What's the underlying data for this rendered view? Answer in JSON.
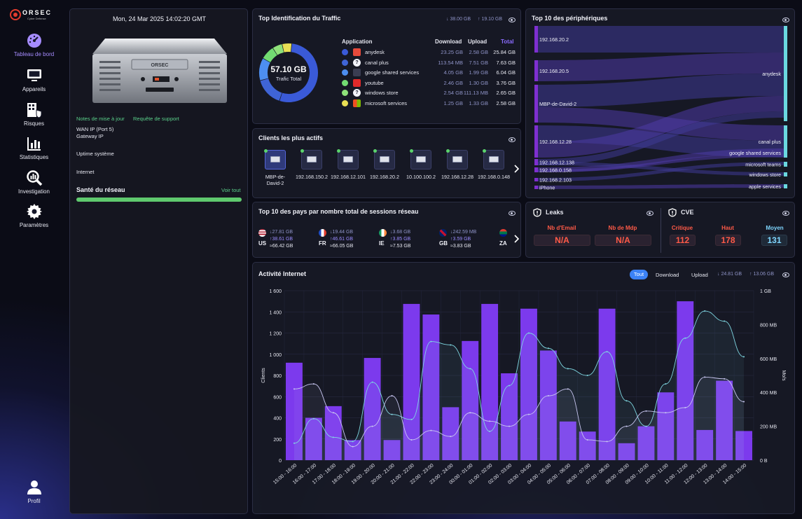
{
  "app": {
    "logo_text": "ORSEC",
    "logo_sub": "Cyber Defense"
  },
  "sidebar": {
    "items": [
      {
        "label": "Tableau de bord",
        "icon": "dashboard-gauge-icon"
      },
      {
        "label": "Appareils",
        "icon": "monitor-icon"
      },
      {
        "label": "Risques",
        "icon": "building-shield-icon"
      },
      {
        "label": "Statistiques",
        "icon": "bar-chart-icon"
      },
      {
        "label": "Investigation",
        "icon": "magnifier-chart-icon"
      },
      {
        "label": "Paramètres",
        "icon": "gear-icon"
      },
      {
        "label": "Profil",
        "icon": "user-icon"
      }
    ]
  },
  "device": {
    "datetime": "Mon, 24 Mar 2025 14:02:20 GMT",
    "notes_link": "Notes de mise à jour",
    "support_link": "Requête de support",
    "wan_ip": "WAN IP (Port 5)",
    "gateway_ip": "Gateway IP",
    "uptime": "Uptime système",
    "internet": "Internet",
    "health_title": "Santé du réseau",
    "health_link": "Voir tout",
    "health_level": 100,
    "device_label": "ORSEC"
  },
  "traffic": {
    "title": "Top Identification du Traffic",
    "download_total": "↓ 38.00 GB",
    "upload_total": "↑ 19.10 GB",
    "donut_value": "57.10 GB",
    "donut_label": "Trafic Total",
    "headers": {
      "app": "Application",
      "download": "Download",
      "upload": "Upload",
      "total": "Total"
    },
    "rows": [
      {
        "color": "#3a5ad8",
        "icon": "anydesk-icon",
        "name": "anydesk",
        "download": "23.25 GB",
        "upload": "2.58 GB",
        "total": "25.84 GB"
      },
      {
        "color": "#3f64d6",
        "icon": "question-icon",
        "name": "canal plus",
        "download": "113.54 MB",
        "upload": "7.51 GB",
        "total": "7.63 GB"
      },
      {
        "color": "#4d8ef0",
        "icon": "google-icon",
        "name": "google shared services",
        "download": "4.05 GB",
        "upload": "1.99 GB",
        "total": "6.04 GB"
      },
      {
        "color": "#72dc72",
        "icon": "youtube-icon",
        "name": "youtube",
        "download": "2.46 GB",
        "upload": "1.30 GB",
        "total": "3.76 GB"
      },
      {
        "color": "#8fe27a",
        "icon": "question-icon",
        "name": "windows store",
        "download": "2.54 GB",
        "upload": "111.13 MB",
        "total": "2.65 GB"
      },
      {
        "color": "#e9df54",
        "icon": "microsoft-icon",
        "name": "microsoft services",
        "download": "1.25 GB",
        "upload": "1.33 GB",
        "total": "2.58 GB"
      }
    ],
    "shares": [
      25.84,
      7.63,
      6.04,
      3.76,
      2.65,
      2.58
    ]
  },
  "clients": {
    "title": "Clients les plus actifs",
    "items": [
      "MBP-de-David-2",
      "192.168.150.2",
      "192.168.12.101",
      "192.168.20.2",
      "10.100.100.2",
      "192.168.12.28",
      "192.168.0.148",
      "192"
    ]
  },
  "countries": {
    "title": "Top 10 des pays par nombre total de sessions réseau",
    "items": [
      {
        "code": "US",
        "down": "↓27.81 GB",
        "up": "↑38.61 GB",
        "total": "≈66.42 GB"
      },
      {
        "code": "FR",
        "down": "↓19.44 GB",
        "up": "↑46.61 GB",
        "total": "≈66.05 GB"
      },
      {
        "code": "IE",
        "down": "↓3.68 GB",
        "up": "↑3.85 GB",
        "total": "≈7.53 GB"
      },
      {
        "code": "GB",
        "down": "↓242.59 MB",
        "up": "↑3.59 GB",
        "total": "≈3.83 GB"
      },
      {
        "code": "ZA",
        "down": "",
        "up": "",
        "total": ""
      }
    ]
  },
  "devices": {
    "title": "Top 10 des périphériques",
    "sources": [
      "192.168.20.2",
      "192.168.20.5",
      "MBP-de-David-2",
      "192.168.12.28",
      "192.168.12.138",
      "192.168.0.158",
      "192.168.2.103",
      "iPhone"
    ],
    "targets": [
      "anydesk",
      "canal plus",
      "google shared services",
      "microsoft teams",
      "windows store",
      "apple services"
    ]
  },
  "leaks": {
    "title": "Leaks",
    "email_label": "Nb d'Email",
    "email_value": "N/A",
    "pwd_label": "Nb de Mdp",
    "pwd_value": "N/A"
  },
  "cve": {
    "title": "CVE",
    "critical_label": "Critique",
    "critical_value": "112",
    "high_label": "Haut",
    "high_value": "178",
    "medium_label": "Moyen",
    "medium_value": "131",
    "critical_color": "#ff5a47",
    "medium_color": "#7fd6ff"
  },
  "activity": {
    "title": "Activité Internet",
    "filter_all": "Tout",
    "filter_download": "Download",
    "filter_upload": "Upload",
    "down_total": "↓ 24.81 GB",
    "up_total": "↑ 13.06 GB"
  },
  "chart_data": {
    "type": "bar",
    "title": "Activité Internet",
    "ylabel": "Clients",
    "y2label": "Mo/s",
    "ylim": [
      0,
      1600
    ],
    "y2lim": [
      0,
      1000
    ],
    "yticks": [
      "0",
      "200",
      "400",
      "600",
      "800",
      "1 000",
      "1 200",
      "1 400",
      "1 600"
    ],
    "y2ticks": [
      "0 B",
      "200 MB",
      "400 MB",
      "600 MB",
      "800 MB",
      "1 GB"
    ],
    "categories": [
      "15:00 - 16:00",
      "16:00 - 17:00",
      "17:00 - 18:00",
      "18:00 - 19:00",
      "19:00 - 20:00",
      "20:00 - 21:00",
      "21:00 - 22:00",
      "22:00 - 23:00",
      "23:00 - 24:00",
      "00:00 - 01:00",
      "01:00 - 02:00",
      "02:00 - 03:00",
      "03:00 - 04:00",
      "04:00 - 05:00",
      "05:00 - 06:00",
      "06:00 - 07:00",
      "07:00 - 08:00",
      "08:00 - 09:00",
      "09:00 - 10:00",
      "10:00 - 11:00",
      "11:00 - 12:00",
      "12:00 - 13:00",
      "13:00 - 14:00",
      "14:00 - 15:00"
    ],
    "series": [
      {
        "name": "Clients",
        "values": [
          920,
          400,
          510,
          190,
          965,
          190,
          1475,
          1375,
          500,
          1125,
          1475,
          820,
          1430,
          1035,
          365,
          270,
          1430,
          160,
          320,
          640,
          1500,
          285,
          750,
          275
        ]
      },
      {
        "name": "Download",
        "values": [
          100,
          245,
          135,
          110,
          460,
          270,
          240,
          700,
          680,
          540,
          170,
          440,
          750,
          660,
          540,
          500,
          640,
          350,
          200,
          450,
          720,
          880,
          820,
          610
        ]
      },
      {
        "name": "Upload",
        "values": [
          420,
          450,
          280,
          80,
          200,
          380,
          120,
          175,
          140,
          280,
          230,
          200,
          270,
          380,
          420,
          120,
          110,
          200,
          290,
          280,
          310,
          490,
          480,
          345
        ]
      }
    ]
  }
}
